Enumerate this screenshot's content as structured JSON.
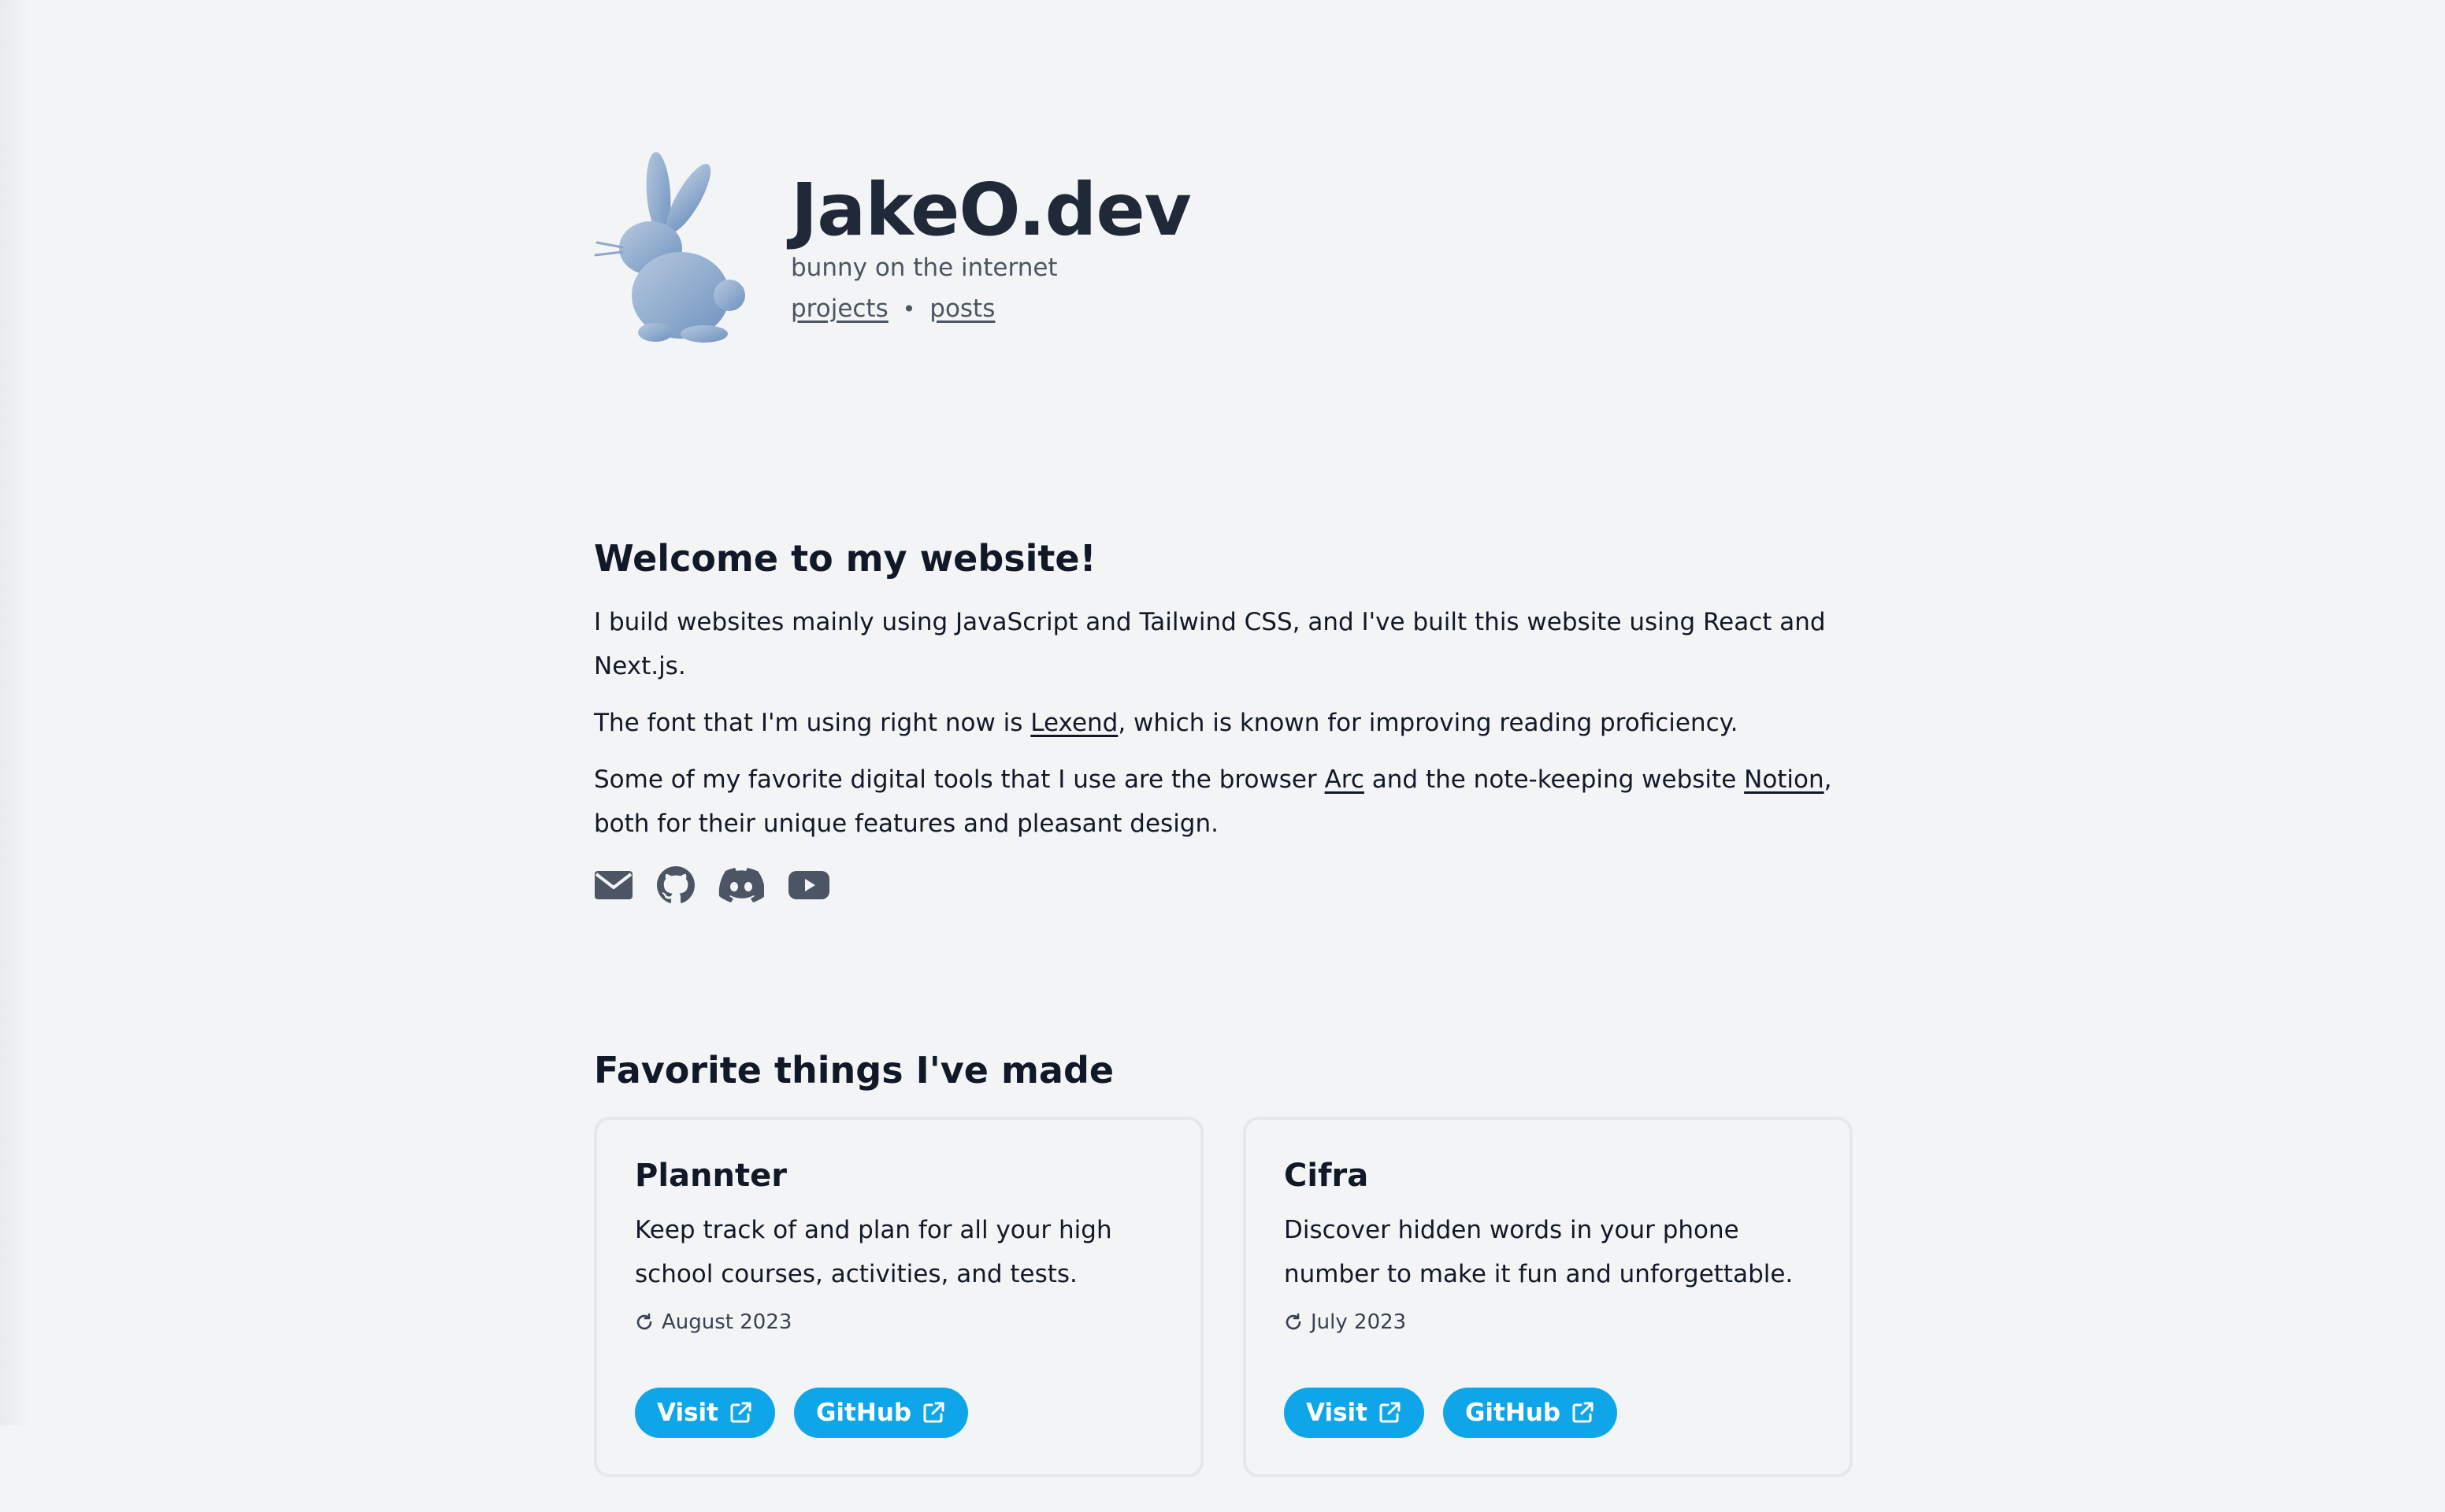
{
  "site": {
    "title": "JakeO.dev",
    "tagline": "bunny on the internet",
    "logo_icon": "bunny-logo-icon"
  },
  "nav": {
    "projects": "projects",
    "separator": "•",
    "posts": "posts"
  },
  "welcome": {
    "heading": "Welcome to my website!",
    "p1": "I build websites mainly using JavaScript and Tailwind CSS, and I've built this website using React and Next.js.",
    "p2_before": "The font that I'm using right now is ",
    "p2_link": "Lexend",
    "p2_after": ", which is known for improving reading proficiency.",
    "p3_before": "Some of my favorite digital tools that I use are the browser ",
    "p3_link1": "Arc",
    "p3_middle": " and the note-keeping website ",
    "p3_link2": "Notion",
    "p3_after": ", both for their unique features and pleasant design."
  },
  "socials": [
    {
      "icon": "email-icon"
    },
    {
      "icon": "github-icon"
    },
    {
      "icon": "discord-icon"
    },
    {
      "icon": "youtube-icon"
    }
  ],
  "favorites": {
    "heading": "Favorite things I've made",
    "projects": [
      {
        "name": "Plannter",
        "description": "Keep track of and plan for all your high school courses, activities, and tests.",
        "date": "August 2023",
        "visit_label": "Visit",
        "github_label": "GitHub"
      },
      {
        "name": "Cifra",
        "description": "Discover hidden words in your phone number to make it fun and unforgettable.",
        "date": "July 2023",
        "visit_label": "Visit",
        "github_label": "GitHub"
      }
    ]
  },
  "colors": {
    "background": "#f3f4f6",
    "text": "#111827",
    "muted": "#4b5563",
    "accent": "#0ea5e9",
    "icon": "#4b5563"
  }
}
